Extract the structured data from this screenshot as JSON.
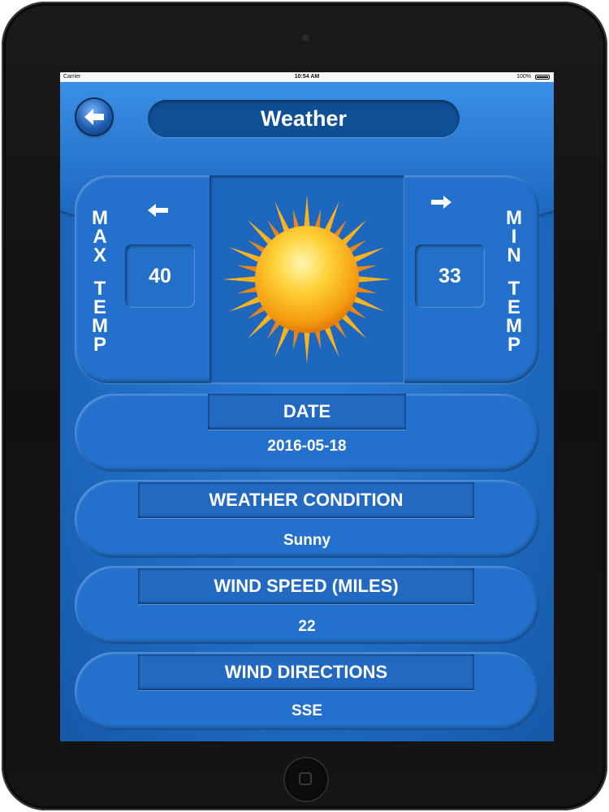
{
  "statusbar": {
    "carrier": "Carrier",
    "time": "10:54 AM",
    "battery": "100%"
  },
  "header": {
    "title": "Weather",
    "back_icon": "back-arrow-icon"
  },
  "temperature": {
    "max_label": [
      "M",
      "A",
      "X",
      "T",
      "E",
      "M",
      "P"
    ],
    "max_value": "40",
    "min_label": [
      "M",
      "I",
      "N",
      "T",
      "E",
      "M",
      "P"
    ],
    "min_value": "33",
    "condition_icon": "sun-icon"
  },
  "cards": [
    {
      "label": "DATE",
      "value": "2016-05-18"
    },
    {
      "label": "WEATHER CONDITION",
      "value": "Sunny"
    },
    {
      "label": "WIND SPEED (MILES)",
      "value": "22"
    },
    {
      "label": "WIND DIRECTIONS",
      "value": "SSE"
    }
  ],
  "colors": {
    "accent": "#1f6cc4",
    "dark_pill": "#0f4f95",
    "text": "#ffffff"
  }
}
